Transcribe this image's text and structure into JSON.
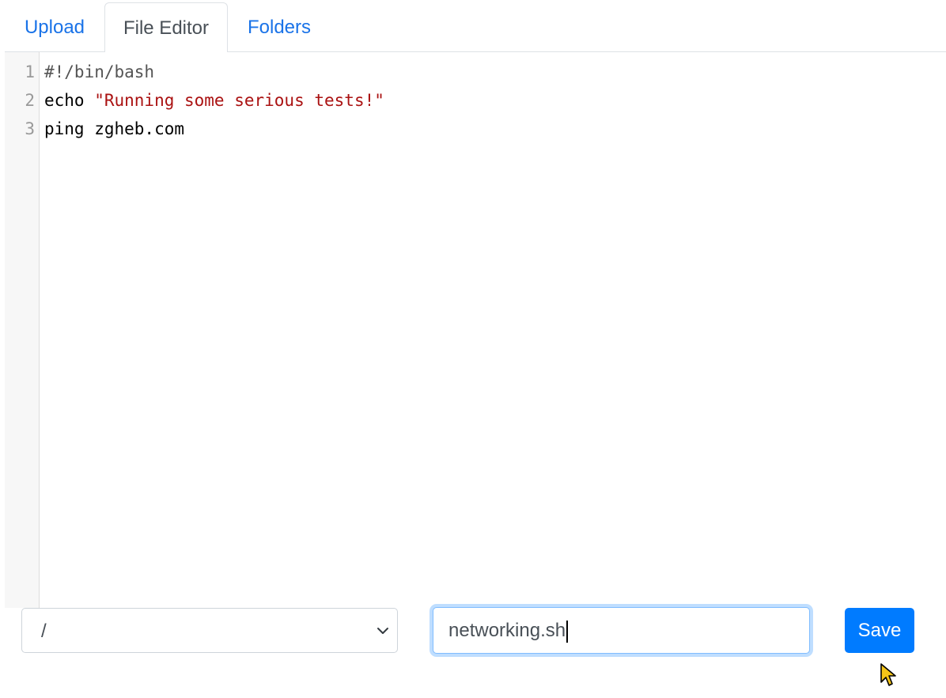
{
  "tabs": [
    {
      "label": "Upload",
      "active": false
    },
    {
      "label": "File Editor",
      "active": true
    },
    {
      "label": "Folders",
      "active": false
    }
  ],
  "editor": {
    "line_numbers": [
      "1",
      "2",
      "3"
    ],
    "lines": [
      {
        "comment": "#!/bin/bash"
      },
      {
        "keyword": "echo ",
        "string": "\"Running some serious tests!\""
      },
      {
        "text": "ping zgheb.com"
      }
    ]
  },
  "folder_select": {
    "selected_value": "/"
  },
  "filename_input": {
    "value": "networking.sh"
  },
  "save_button": {
    "label": "Save"
  },
  "colors": {
    "accent": "#007bff",
    "tab_link": "#1a73e8",
    "string": "#aa1111",
    "focus_ring": "#80bdff"
  },
  "icons": {
    "select_arrow": "chevron-down-icon",
    "pointer": "mouse-pointer-icon"
  }
}
